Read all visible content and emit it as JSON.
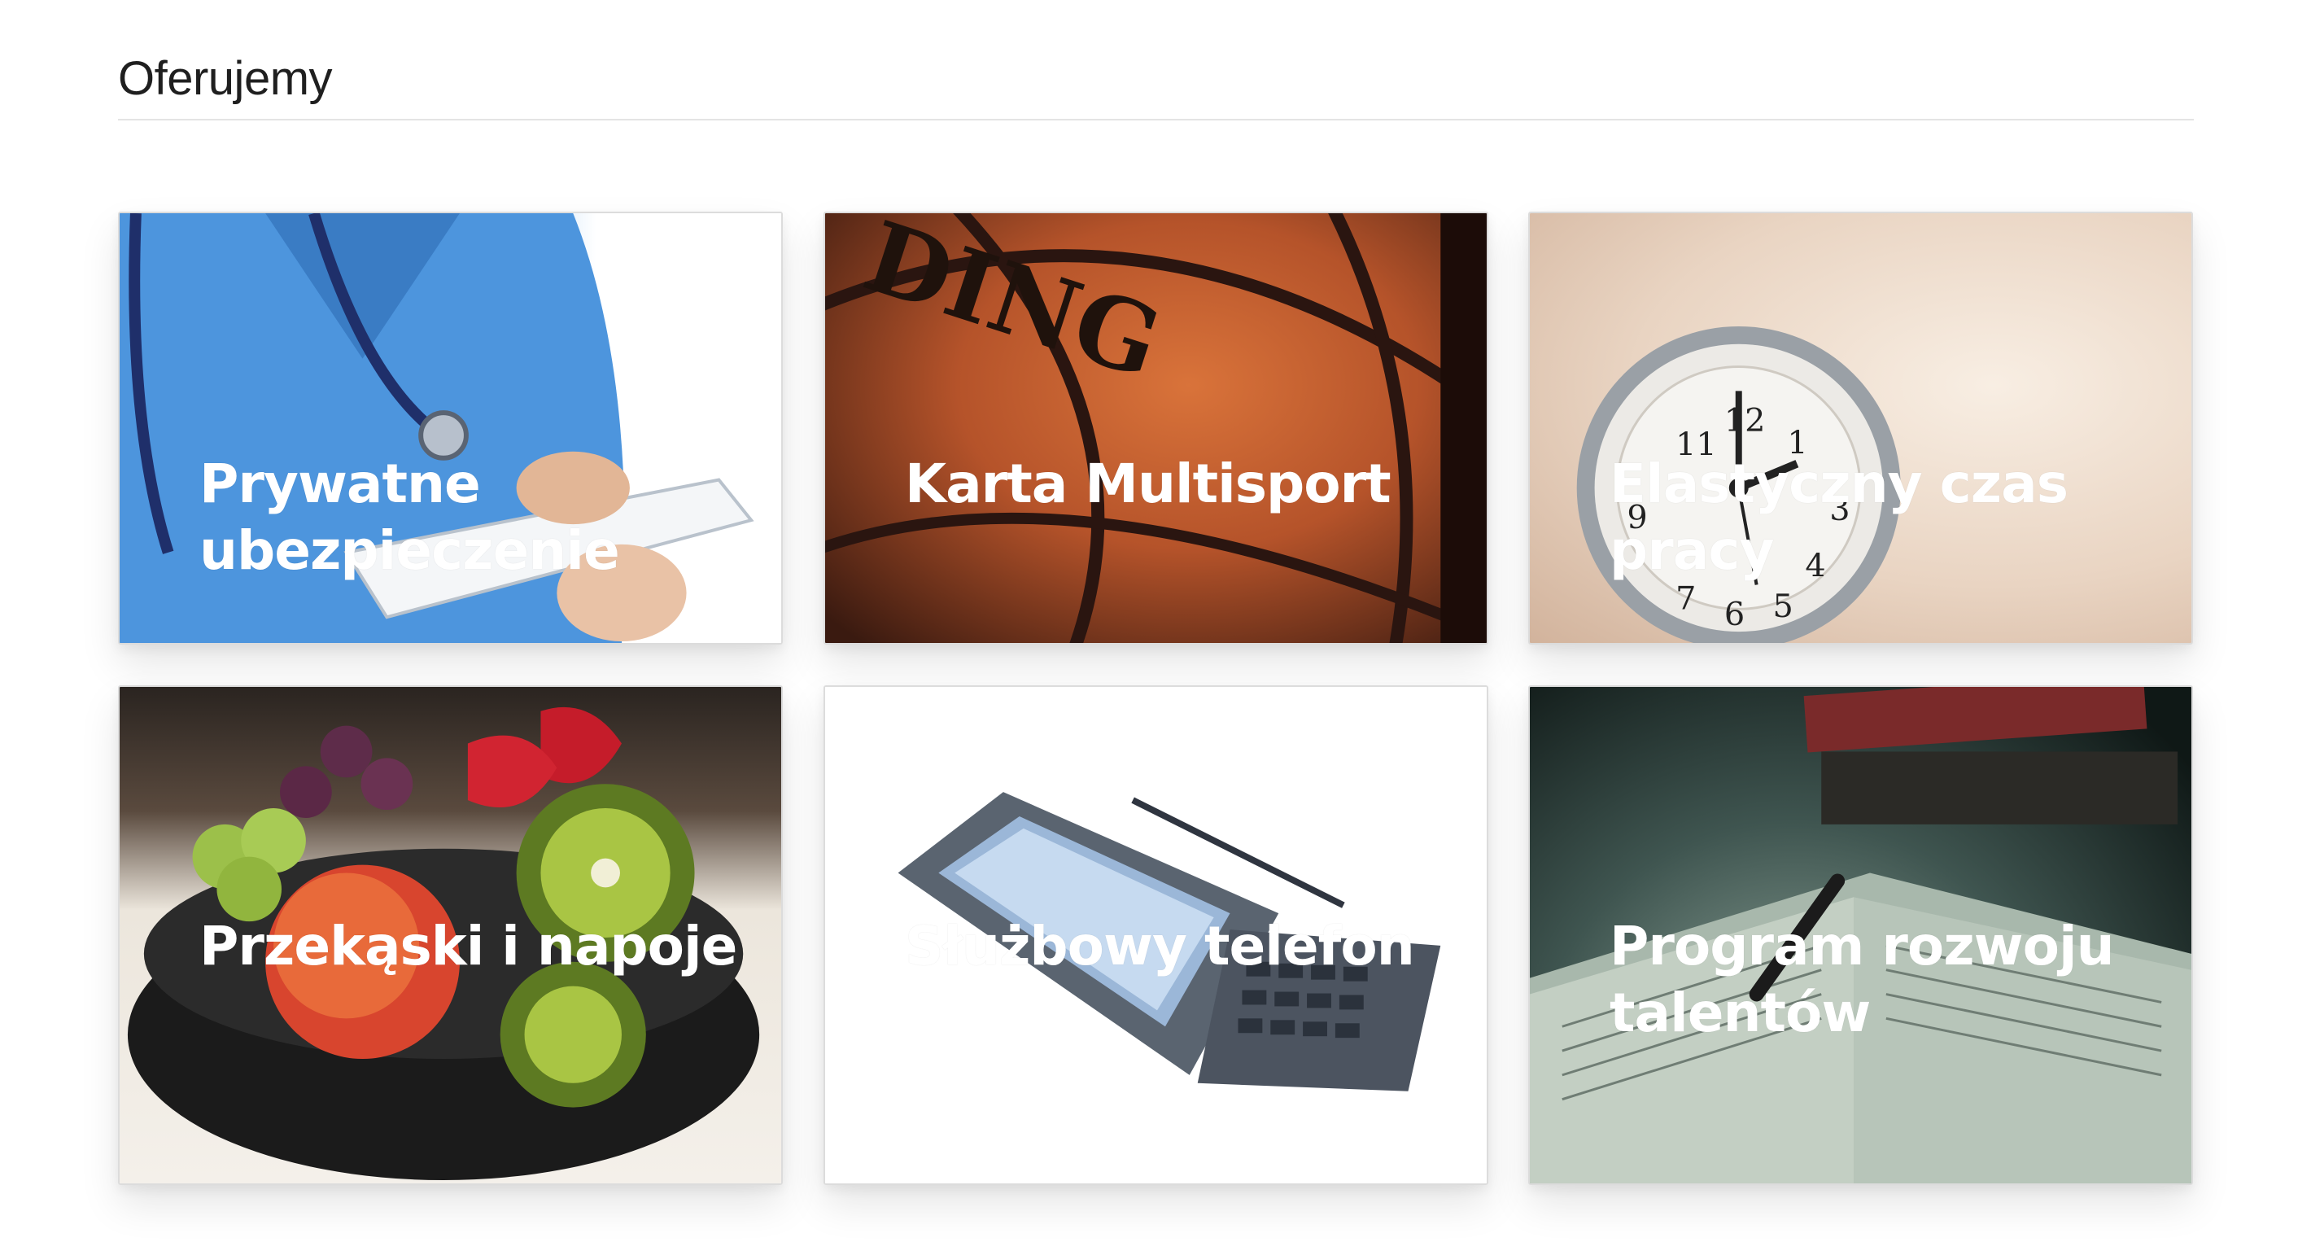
{
  "section": {
    "title": "Oferujemy"
  },
  "benefits": [
    {
      "label": "Prywatne ubezpieczenie"
    },
    {
      "label": "Karta Multisport"
    },
    {
      "label": "Elastyczny czas pracy"
    },
    {
      "label": "Przekąski i napoje"
    },
    {
      "label": "Służbowy telefon"
    },
    {
      "label": "Program rozwoju talentów"
    }
  ]
}
